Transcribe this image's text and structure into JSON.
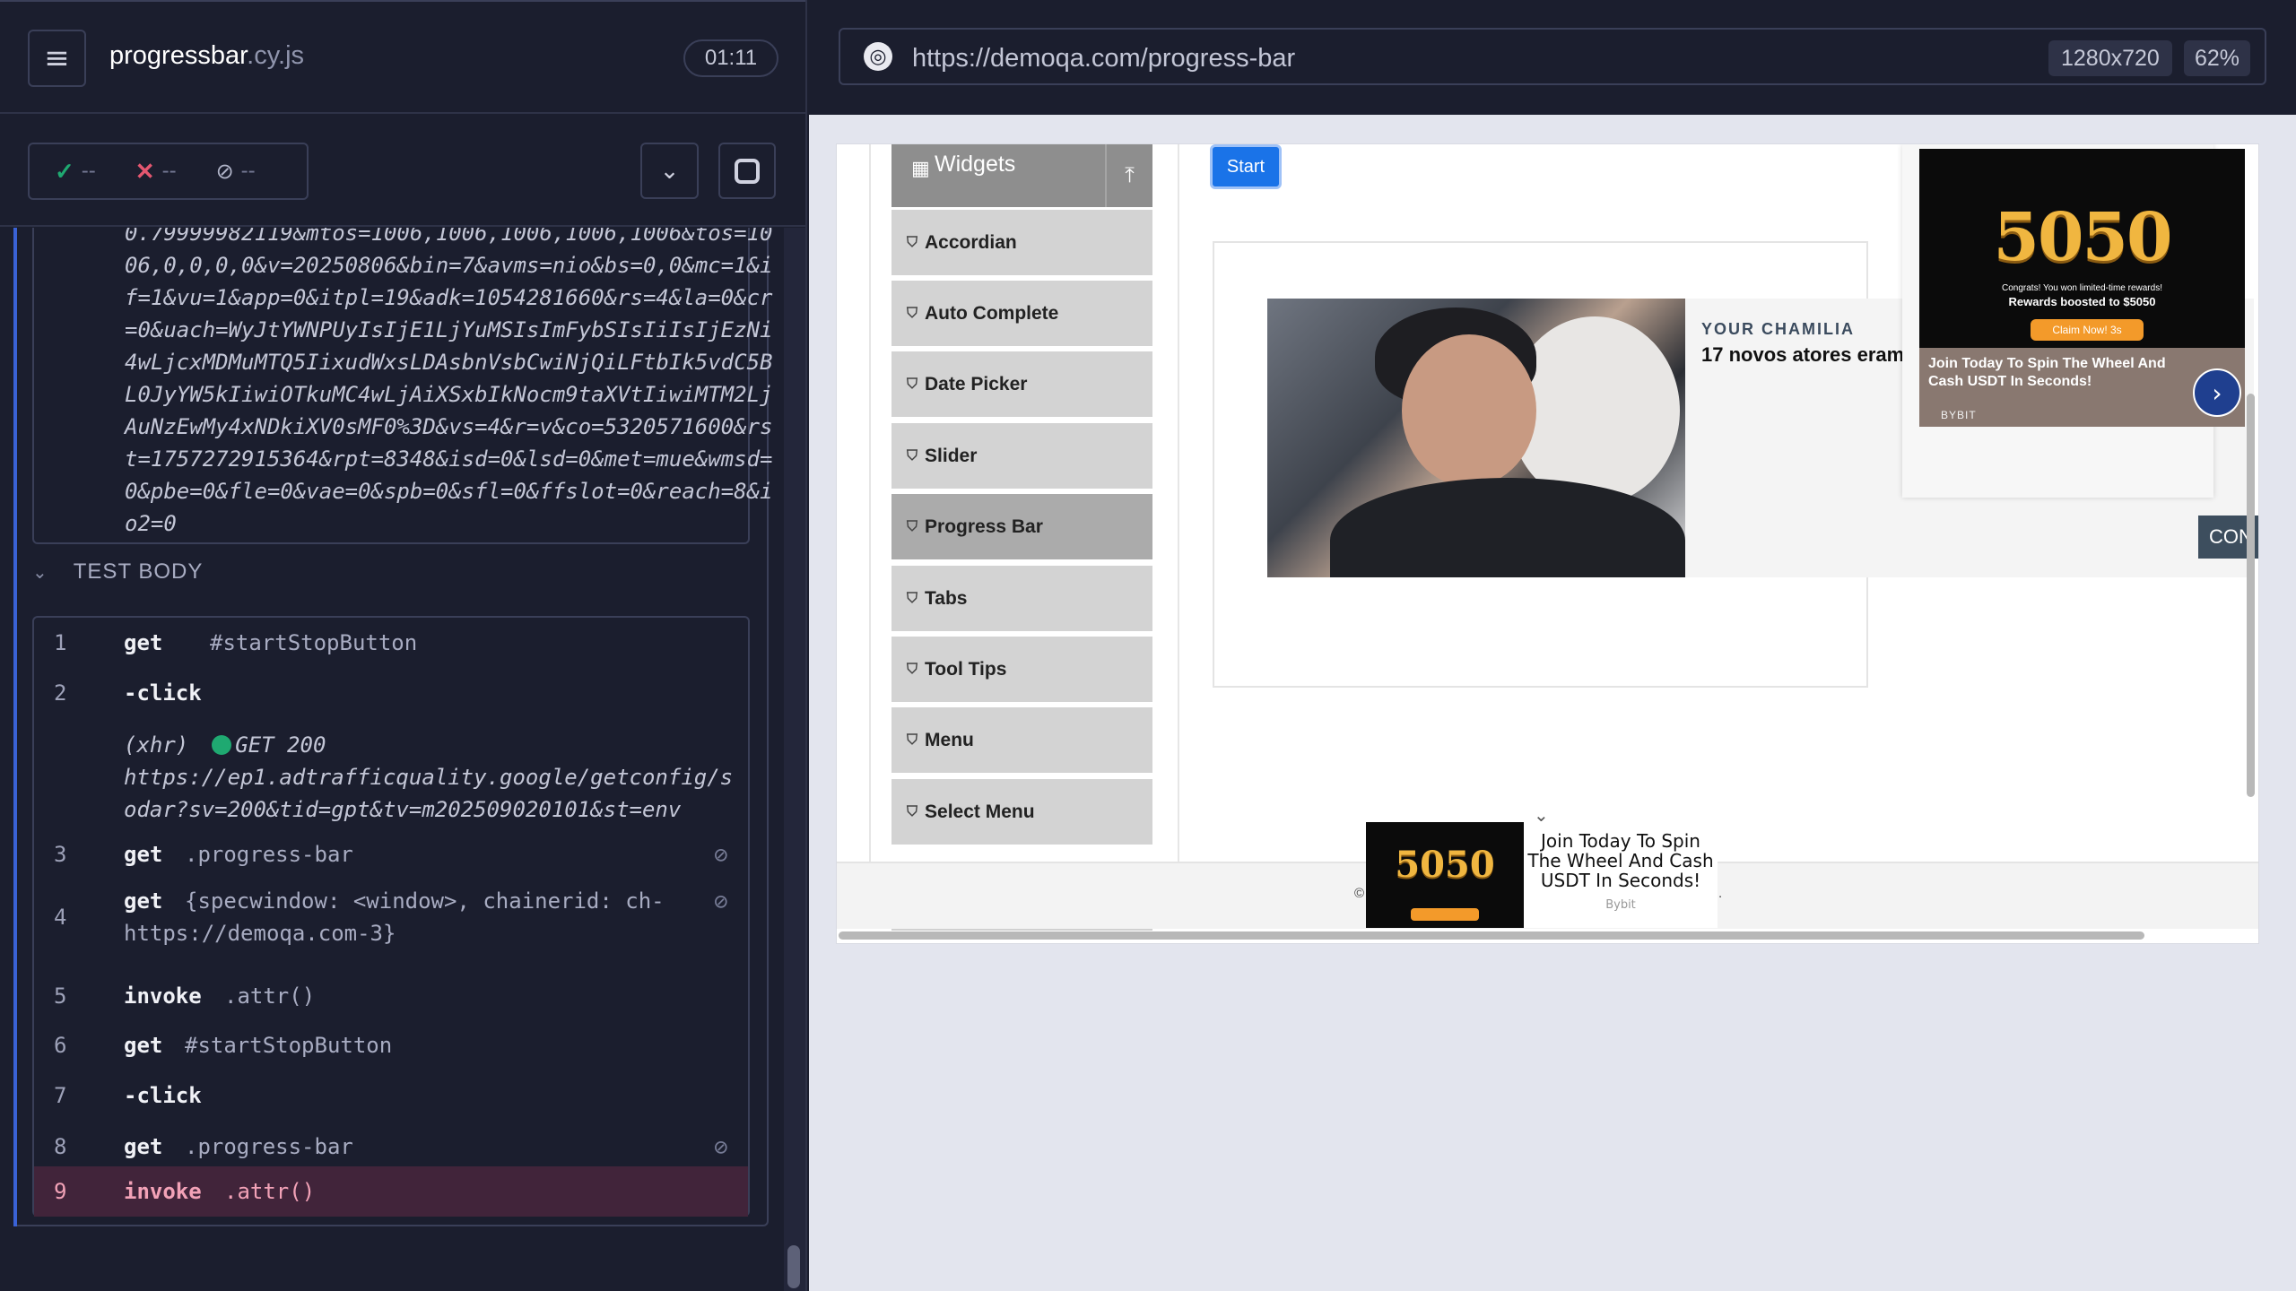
{
  "runner": {
    "spec_name": "progressbar",
    "spec_ext": ".cy.js",
    "timer": "01:11",
    "stats": {
      "passed": "--",
      "failed": "--",
      "pending": "--"
    }
  },
  "log": {
    "url_text": "0.79999982119&mtos=1006,1006,1006,1006,1006&tos=1006,0,0,0,0&v=20250806&bin=7&avms=nio&bs=0,0&mc=1&if=1&vu=1&app=0&itpl=19&adk=1054281660&rs=4&la=0&cr=0&uach=WyJtYWNPUyIsIjE1LjYuMSIsImFybSIsIiIsIjEzNi4wLjcxMDMuMTQ5IixudWxsLDAsbnVsbCwiNjQiLFtbIk5vdC5BL0JyYW5kIiwiOTkuMC4wLjAiXSxbIkNocm9taXVtIiwiMTM2LjAuNzEwMy4xNDkiXV0sMF0%3D&vs=4&r=v&co=5320571600&rst=1757272915364&rpt=8348&isd=0&lsd=0&met=mue&wmsd=0&pbe=0&fle=0&vae=0&spb=0&sfl=0&ffslot=0&reach=8&io2=0",
    "section_title": "TEST BODY",
    "commands": [
      {
        "num": "1",
        "name": "get",
        "msg": "#startStopButton"
      },
      {
        "num": "2",
        "name": "-click",
        "msg": ""
      },
      {
        "num": "3",
        "name": "get",
        "msg": ".progress-bar"
      },
      {
        "num": "4",
        "name": "get",
        "msg": "{specwindow: <window>, chainerid: ch-",
        "msg2": "https://demoqa.com-3}"
      },
      {
        "num": "5",
        "name": "invoke",
        "msg": ".attr()"
      },
      {
        "num": "6",
        "name": "get",
        "msg": "#startStopButton"
      },
      {
        "num": "7",
        "name": "-click",
        "msg": ""
      },
      {
        "num": "8",
        "name": "get",
        "msg": ".progress-bar"
      },
      {
        "num": "9",
        "name": "invoke",
        "msg": ".attr()"
      }
    ],
    "xhr": {
      "label": "(xhr)",
      "status": "GET 200",
      "url": "https://ep1.adtrafficquality.google/getconfig/sodar?sv=200&tid=gpt&tv=m202509020101&st=env"
    }
  },
  "browser": {
    "url": "https://demoqa.com/progress-bar",
    "viewport": "1280x720",
    "zoom": "62%"
  },
  "aut": {
    "group_label": "Widgets",
    "menu": [
      "Accordian",
      "Auto Complete",
      "Date Picker",
      "Slider",
      "Progress Bar",
      "Tabs",
      "Tool Tips",
      "Menu",
      "Select Menu"
    ],
    "active_menu": "Progress Bar",
    "start_label": "Start",
    "ad": {
      "brand": "YOUR CHAMILIA",
      "headline": "17 novos atores eram",
      "cont": "CON"
    },
    "bybit": {
      "big": "5050",
      "line1": "Congrats! You won limited-time rewards!",
      "line2": "Rewards boosted to $5050",
      "claim": "Claim Now! 3s",
      "caption": "Join Today To Spin The Wheel And Cash USDT In Seconds!",
      "brand": "BYBIT"
    },
    "bottom_ad": {
      "big": "5050",
      "text": "Join Today To Spin The Wheel And Cash USDT In Seconds!",
      "source": "Bybit"
    },
    "footer_left": "©",
    "footer_right": "."
  },
  "colors": {
    "accent_blue": "#3a62d6",
    "pass": "#1fa971",
    "fail": "#e45770",
    "active_row": "#41243a"
  }
}
